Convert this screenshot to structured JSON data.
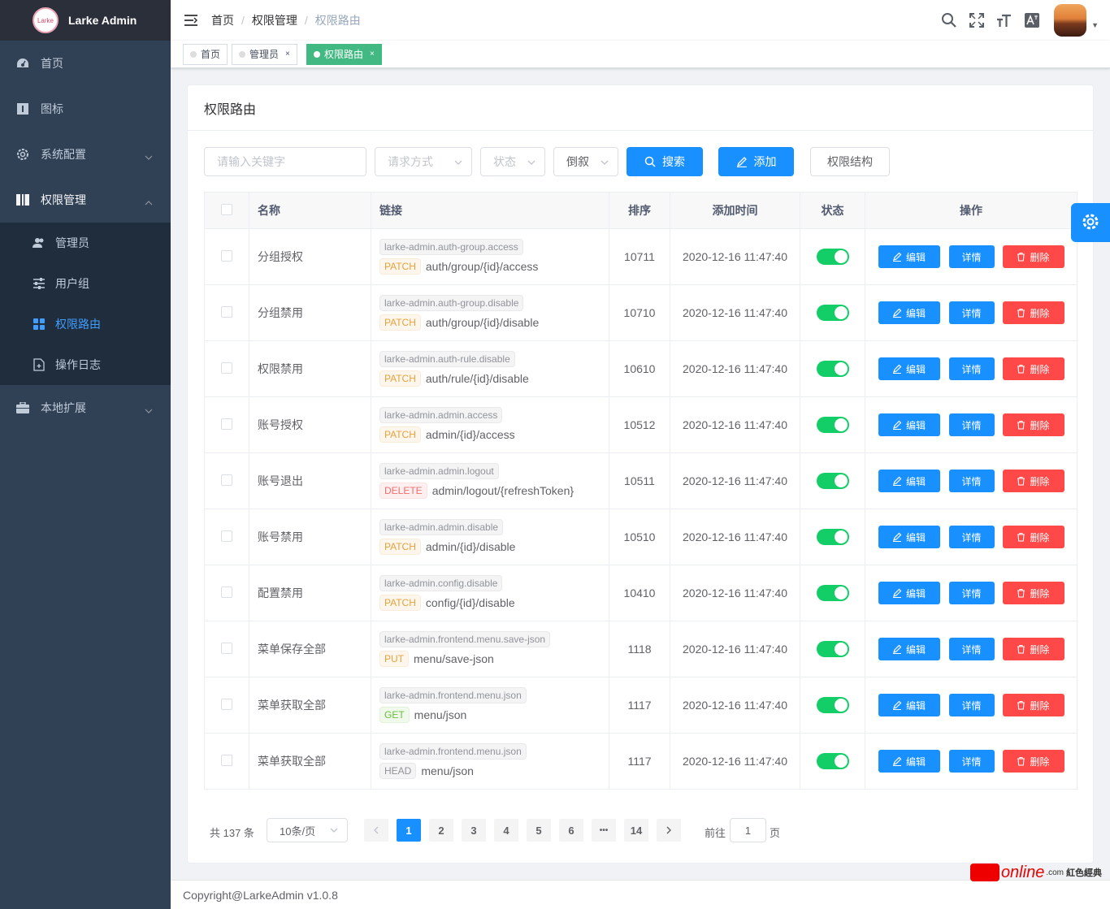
{
  "sidebar": {
    "logo_text": "Larke",
    "title": "Larke Admin",
    "items": [
      {
        "label": "首页"
      },
      {
        "label": "图标"
      },
      {
        "label": "系统配置"
      },
      {
        "label": "权限管理"
      },
      {
        "label": "本地扩展"
      }
    ],
    "sub_items": [
      {
        "label": "管理员"
      },
      {
        "label": "用户组"
      },
      {
        "label": "权限路由"
      },
      {
        "label": "操作日志"
      }
    ]
  },
  "navbar": {
    "breadcrumb": [
      "首页",
      "权限管理",
      "权限路由"
    ],
    "separator": "/"
  },
  "tags": [
    {
      "label": "首页"
    },
    {
      "label": "管理员"
    },
    {
      "label": "权限路由"
    }
  ],
  "card": {
    "title": "权限路由",
    "keyword_placeholder": "请输入关键字",
    "method_placeholder": "请求方式",
    "status_placeholder": "状态",
    "order_value": "倒叙",
    "search_label": "搜索",
    "add_label": "添加",
    "tree_label": "权限结构"
  },
  "table": {
    "headers": {
      "name": "名称",
      "link": "链接",
      "sort": "排序",
      "time": "添加时间",
      "status": "状态",
      "ops": "操作"
    },
    "edit_label": "编辑",
    "detail_label": "详情",
    "delete_label": "删除",
    "rows": [
      {
        "name": "分组授权",
        "slug": "larke-admin.auth-group.access",
        "method": "PATCH",
        "url": "auth/group/{id}/access",
        "sort": "10711",
        "time": "2020-12-16 11:47:40",
        "status": true
      },
      {
        "name": "分组禁用",
        "slug": "larke-admin.auth-group.disable",
        "method": "PATCH",
        "url": "auth/group/{id}/disable",
        "sort": "10710",
        "time": "2020-12-16 11:47:40",
        "status": true
      },
      {
        "name": "权限禁用",
        "slug": "larke-admin.auth-rule.disable",
        "method": "PATCH",
        "url": "auth/rule/{id}/disable",
        "sort": "10610",
        "time": "2020-12-16 11:47:40",
        "status": true
      },
      {
        "name": "账号授权",
        "slug": "larke-admin.admin.access",
        "method": "PATCH",
        "url": "admin/{id}/access",
        "sort": "10512",
        "time": "2020-12-16 11:47:40",
        "status": true
      },
      {
        "name": "账号退出",
        "slug": "larke-admin.admin.logout",
        "method": "DELETE",
        "url": "admin/logout/{refreshToken}",
        "sort": "10511",
        "time": "2020-12-16 11:47:40",
        "status": true
      },
      {
        "name": "账号禁用",
        "slug": "larke-admin.admin.disable",
        "method": "PATCH",
        "url": "admin/{id}/disable",
        "sort": "10510",
        "time": "2020-12-16 11:47:40",
        "status": true
      },
      {
        "name": "配置禁用",
        "slug": "larke-admin.config.disable",
        "method": "PATCH",
        "url": "config/{id}/disable",
        "sort": "10410",
        "time": "2020-12-16 11:47:40",
        "status": true
      },
      {
        "name": "菜单保存全部",
        "slug": "larke-admin.frontend.menu.save-json",
        "method": "PUT",
        "url": "menu/save-json",
        "sort": "1118",
        "time": "2020-12-16 11:47:40",
        "status": true
      },
      {
        "name": "菜单获取全部",
        "slug": "larke-admin.frontend.menu.json",
        "method": "GET",
        "url": "menu/json",
        "sort": "1117",
        "time": "2020-12-16 11:47:40",
        "status": true
      },
      {
        "name": "菜单获取全部",
        "slug": "larke-admin.frontend.menu.json",
        "method": "HEAD",
        "url": "menu/json",
        "sort": "1117",
        "time": "2020-12-16 11:47:40",
        "status": true
      }
    ]
  },
  "pagination": {
    "total": "共 137 条",
    "page_size": "10条/页",
    "pages": [
      "1",
      "2",
      "3",
      "4",
      "5",
      "6",
      "•••",
      "14"
    ],
    "current": "1",
    "goto_label": "前往",
    "goto_value": "1",
    "goto_suffix": "页"
  },
  "footer": {
    "copyright": "Copyright@LarkeAdmin v1.0.8"
  },
  "watermark": {
    "brand": "online",
    "suffix": ".com",
    "cn": "紅色經典"
  },
  "colors": {
    "sidebar_bg": "#304156",
    "primary": "#1890ff",
    "danger": "#ff4949",
    "switch_on": "#13ce66",
    "active_tag": "#42b983"
  }
}
